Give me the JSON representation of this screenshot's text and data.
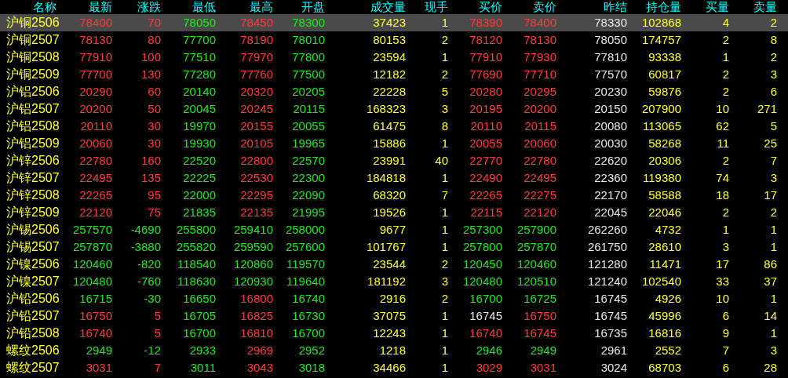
{
  "columns": [
    {
      "label": "名称",
      "kind": "name"
    },
    {
      "label": "最新",
      "kind": "price"
    },
    {
      "label": "涨跌",
      "kind": "change"
    },
    {
      "label": "最低",
      "kind": "price"
    },
    {
      "label": "最高",
      "kind": "price"
    },
    {
      "label": "开盘",
      "kind": "price"
    },
    {
      "label": "成交量",
      "kind": "volume"
    },
    {
      "label": "现手",
      "kind": "volume"
    },
    {
      "label": "买价",
      "kind": "price"
    },
    {
      "label": "卖价",
      "kind": "price"
    },
    {
      "label": "昨结",
      "kind": "settle"
    },
    {
      "label": "持仓量",
      "kind": "volume"
    },
    {
      "label": "买量",
      "kind": "volume"
    },
    {
      "label": "卖量",
      "kind": "volume"
    }
  ],
  "rows": [
    {
      "selected": true,
      "cells": [
        "沪铜2506",
        "78400",
        "70",
        "78050",
        "78450",
        "78300",
        "37423",
        "1",
        "78390",
        "78400",
        "78330",
        "102868",
        "4",
        "2"
      ]
    },
    {
      "selected": false,
      "cells": [
        "沪铜2507",
        "78130",
        "80",
        "77700",
        "78190",
        "78010",
        "80153",
        "2",
        "78120",
        "78130",
        "78050",
        "174757",
        "2",
        "8"
      ]
    },
    {
      "selected": false,
      "cells": [
        "沪铜2508",
        "77910",
        "100",
        "77510",
        "77970",
        "77800",
        "23594",
        "1",
        "77910",
        "77930",
        "77810",
        "93338",
        "1",
        "2"
      ]
    },
    {
      "selected": false,
      "cells": [
        "沪铜2509",
        "77700",
        "130",
        "77280",
        "77760",
        "77500",
        "12182",
        "2",
        "77690",
        "77710",
        "77570",
        "60817",
        "2",
        "3"
      ]
    },
    {
      "selected": false,
      "cells": [
        "沪铝2506",
        "20290",
        "60",
        "20140",
        "20320",
        "20205",
        "22228",
        "5",
        "20280",
        "20295",
        "20230",
        "59876",
        "2",
        "6"
      ]
    },
    {
      "selected": false,
      "cells": [
        "沪铝2507",
        "20200",
        "50",
        "20045",
        "20245",
        "20115",
        "168323",
        "3",
        "20195",
        "20200",
        "20150",
        "207900",
        "10",
        "271"
      ]
    },
    {
      "selected": false,
      "cells": [
        "沪铝2508",
        "20110",
        "30",
        "19970",
        "20155",
        "20055",
        "61475",
        "8",
        "20110",
        "20115",
        "20080",
        "113065",
        "62",
        "5"
      ]
    },
    {
      "selected": false,
      "cells": [
        "沪铝2509",
        "20060",
        "30",
        "19930",
        "20105",
        "19965",
        "15886",
        "1",
        "20055",
        "20060",
        "20030",
        "58268",
        "11",
        "25"
      ]
    },
    {
      "selected": false,
      "cells": [
        "沪锌2506",
        "22780",
        "160",
        "22520",
        "22800",
        "22570",
        "23991",
        "40",
        "22770",
        "22780",
        "22620",
        "20306",
        "2",
        "7"
      ]
    },
    {
      "selected": false,
      "cells": [
        "沪锌2507",
        "22495",
        "135",
        "22225",
        "22530",
        "22300",
        "184818",
        "1",
        "22490",
        "22495",
        "22360",
        "119380",
        "74",
        "3"
      ]
    },
    {
      "selected": false,
      "cells": [
        "沪锌2508",
        "22265",
        "95",
        "22000",
        "22295",
        "22090",
        "68320",
        "7",
        "22265",
        "22275",
        "22170",
        "58588",
        "18",
        "17"
      ]
    },
    {
      "selected": false,
      "cells": [
        "沪锌2509",
        "22120",
        "75",
        "21835",
        "22135",
        "21995",
        "19526",
        "1",
        "22115",
        "22120",
        "22045",
        "22046",
        "2",
        "2"
      ]
    },
    {
      "selected": false,
      "cells": [
        "沪锡2506",
        "257570",
        "-4690",
        "255800",
        "259410",
        "258000",
        "9677",
        "1",
        "257300",
        "257900",
        "262260",
        "4732",
        "1",
        "1"
      ]
    },
    {
      "selected": false,
      "cells": [
        "沪锡2507",
        "257870",
        "-3880",
        "255820",
        "259590",
        "257600",
        "101767",
        "1",
        "257800",
        "257870",
        "261750",
        "28610",
        "3",
        "1"
      ]
    },
    {
      "selected": false,
      "cells": [
        "沪镍2506",
        "120460",
        "-820",
        "118540",
        "120860",
        "119570",
        "23544",
        "2",
        "120450",
        "120460",
        "121280",
        "11471",
        "17",
        "86"
      ]
    },
    {
      "selected": false,
      "cells": [
        "沪镍2507",
        "120480",
        "-760",
        "118630",
        "120930",
        "119640",
        "181192",
        "3",
        "120480",
        "120510",
        "121240",
        "102540",
        "33",
        "37"
      ]
    },
    {
      "selected": false,
      "cells": [
        "沪铅2506",
        "16715",
        "-30",
        "16650",
        "16800",
        "16740",
        "2916",
        "2",
        "16700",
        "16725",
        "16745",
        "4926",
        "10",
        "1"
      ]
    },
    {
      "selected": false,
      "cells": [
        "沪铅2507",
        "16750",
        "5",
        "16705",
        "16825",
        "16730",
        "37075",
        "1",
        "16745",
        "16750",
        "16745",
        "45996",
        "6",
        "14"
      ]
    },
    {
      "selected": false,
      "cells": [
        "沪铅2508",
        "16740",
        "5",
        "16700",
        "16810",
        "16700",
        "12243",
        "1",
        "16740",
        "16745",
        "16735",
        "16816",
        "9",
        "1"
      ]
    },
    {
      "selected": false,
      "cells": [
        "螺纹2506",
        "2949",
        "-12",
        "2933",
        "2969",
        "2952",
        "1218",
        "1",
        "2946",
        "2949",
        "2961",
        "2552",
        "7",
        "3"
      ]
    },
    {
      "selected": false,
      "cells": [
        "螺纹2507",
        "3031",
        "7",
        "3011",
        "3043",
        "3018",
        "34466",
        "1",
        "3029",
        "3031",
        "3024",
        "68703",
        "6",
        "28"
      ]
    }
  ]
}
